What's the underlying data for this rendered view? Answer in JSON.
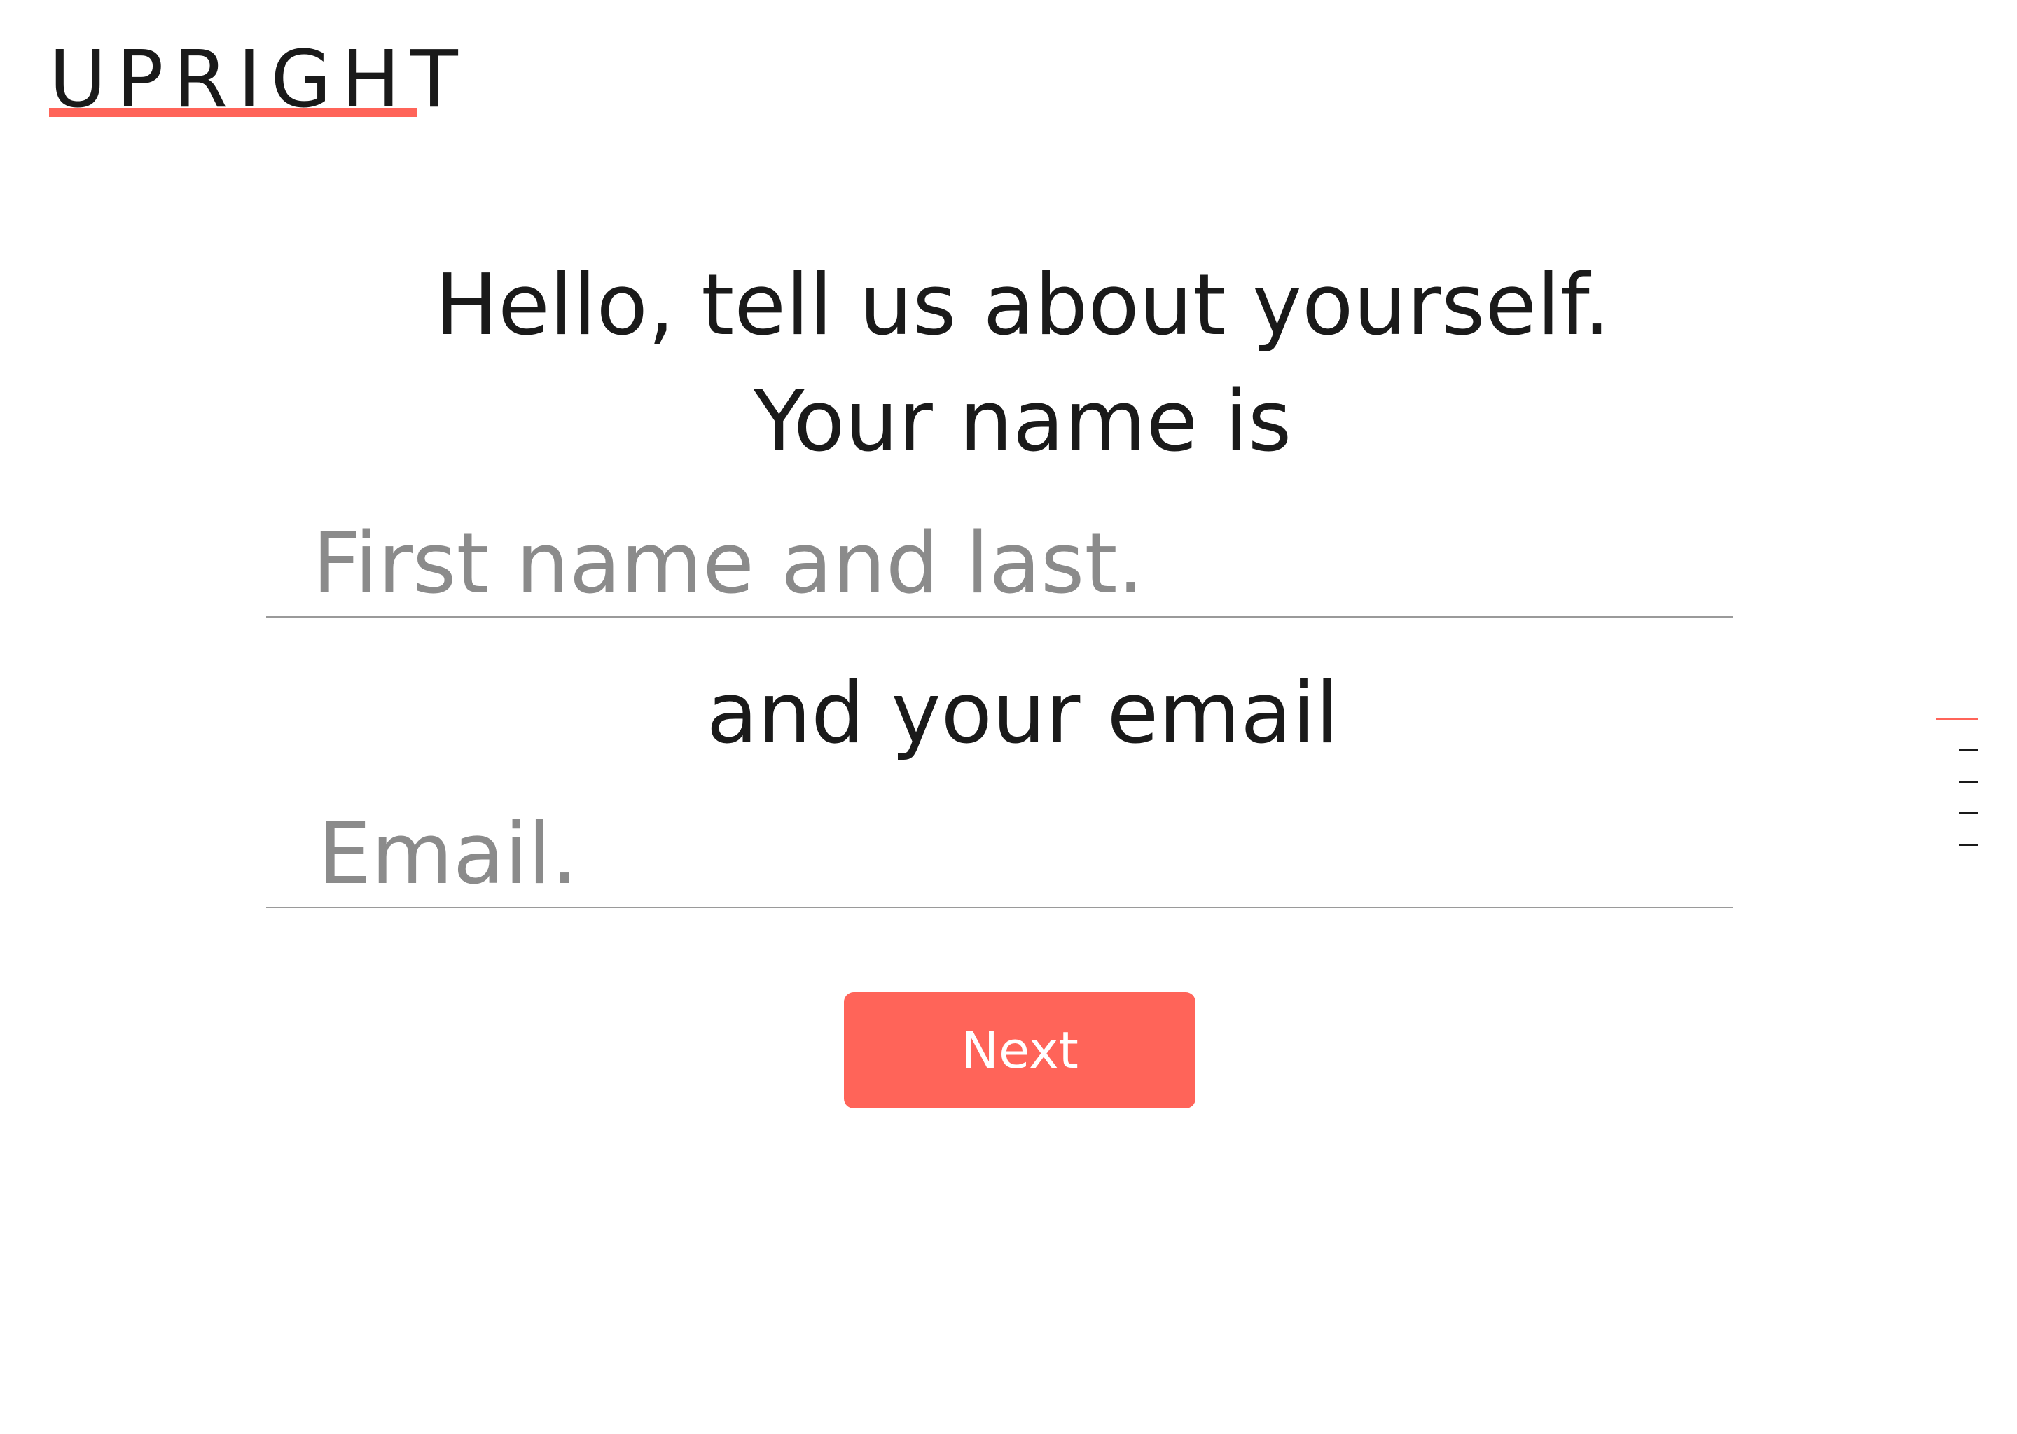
{
  "logo": {
    "text": "UPRIGHT",
    "accent_color": "#ff6459"
  },
  "form": {
    "heading_line1": "Hello, tell us about yourself.",
    "heading_line2": "Your name is",
    "name_placeholder": "First name and last.",
    "email_heading": "and your email",
    "email_placeholder": "Email.",
    "next_label": "Next"
  },
  "progress": {
    "total_steps": 5,
    "current_step": 1
  },
  "colors": {
    "accent": "#ff6459",
    "text": "#1a1a1a",
    "placeholder": "#8b8b8b",
    "divider": "#9a9a9a"
  }
}
